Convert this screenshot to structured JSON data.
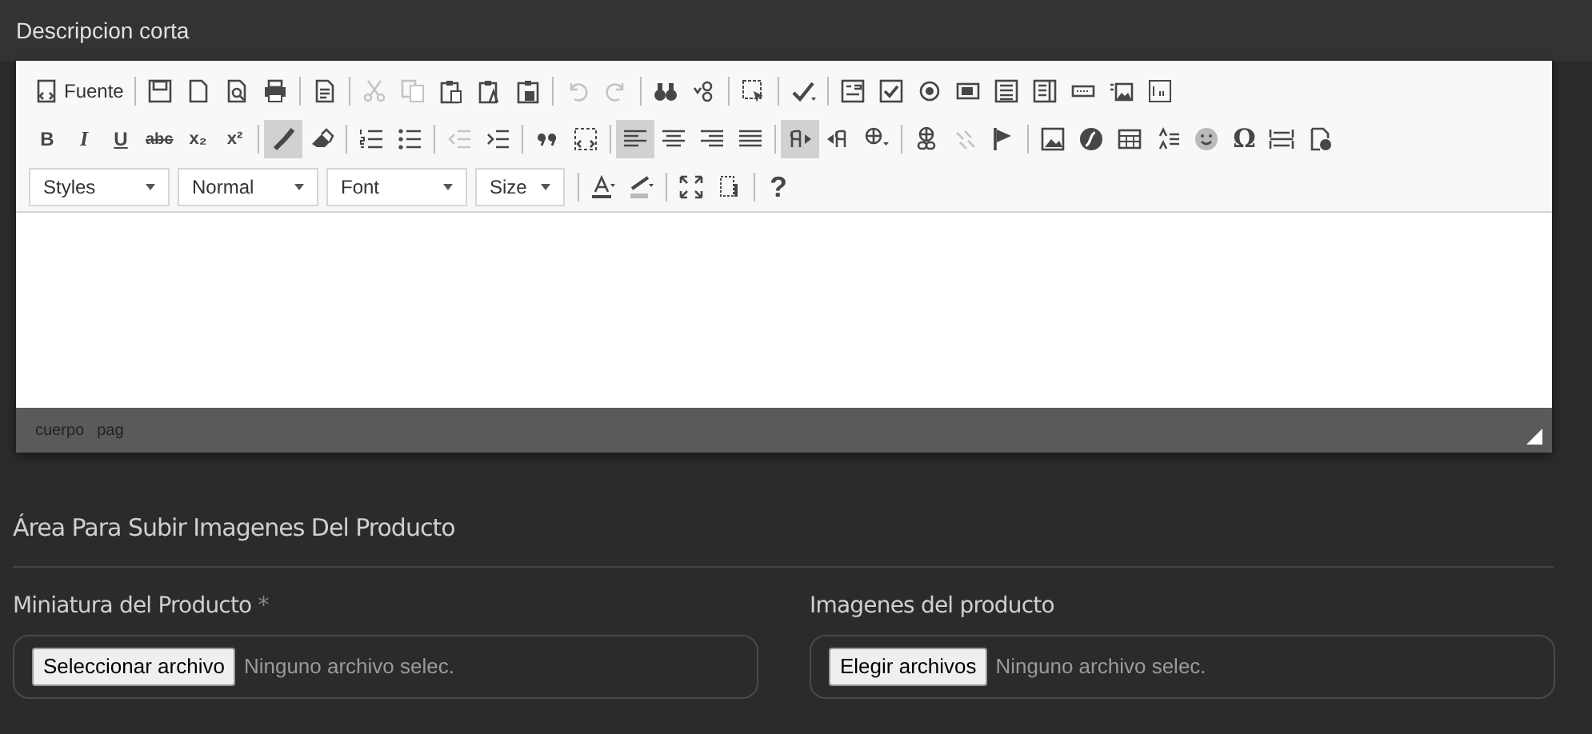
{
  "section_title": "Descripcion corta",
  "toolbar": {
    "rows": [
      [
        {
          "kind": "buttons",
          "items": [
            {
              "label": "Fuente",
              "selected": false,
              "disabled": false
            }
          ]
        },
        {
          "kind": "buttons",
          "items": [
            {
              "selected": false,
              "disabled": false
            },
            {
              "selected": false,
              "disabled": false
            },
            {
              "selected": false,
              "disabled": false
            },
            {
              "selected": false,
              "disabled": false
            }
          ]
        },
        {
          "kind": "buttons",
          "items": [
            {
              "selected": false,
              "disabled": false
            }
          ]
        },
        {
          "kind": "buttons",
          "items": [
            {
              "selected": false,
              "disabled": true
            },
            {
              "selected": false,
              "disabled": true
            },
            {
              "selected": false,
              "disabled": false
            },
            {
              "selected": false,
              "disabled": false
            },
            {
              "selected": false,
              "disabled": false
            }
          ]
        },
        {
          "kind": "buttons",
          "items": [
            {
              "selected": false,
              "disabled": true
            },
            {
              "selected": false,
              "disabled": true
            }
          ]
        },
        {
          "kind": "buttons",
          "items": [
            {
              "selected": false,
              "disabled": false
            },
            {
              "selected": false,
              "disabled": false
            }
          ]
        },
        {
          "kind": "buttons",
          "items": [
            {
              "selected": false,
              "disabled": false
            }
          ]
        },
        {
          "kind": "buttons",
          "items": [
            {
              "selected": false,
              "disabled": false
            }
          ]
        },
        {
          "kind": "buttons",
          "items": [
            {
              "selected": false,
              "disabled": false
            },
            {
              "selected": false,
              "disabled": false
            },
            {
              "selected": false,
              "disabled": false
            },
            {
              "selected": false,
              "disabled": false
            },
            {
              "selected": false,
              "disabled": false
            },
            {
              "selected": false,
              "disabled": false
            },
            {
              "selected": false,
              "disabled": false
            },
            {
              "selected": false,
              "disabled": false
            },
            {
              "selected": false,
              "disabled": false
            }
          ]
        }
      ],
      [
        {
          "kind": "buttons",
          "items": [
            {
              "label": "B",
              "selected": false,
              "disabled": false
            },
            {
              "label": "I",
              "selected": false,
              "disabled": false
            },
            {
              "label": "U",
              "selected": false,
              "disabled": false
            },
            {
              "label": "abc",
              "selected": false,
              "disabled": false
            },
            {
              "label": "x₂",
              "selected": false,
              "disabled": false
            },
            {
              "label": "x²",
              "selected": false,
              "disabled": false
            }
          ]
        },
        {
          "kind": "buttons",
          "items": [
            {
              "selected": true,
              "disabled": false
            },
            {
              "selected": false,
              "disabled": false
            }
          ]
        },
        {
          "kind": "buttons",
          "items": [
            {
              "selected": false,
              "disabled": false
            },
            {
              "selected": false,
              "disabled": false
            }
          ]
        },
        {
          "kind": "buttons",
          "items": [
            {
              "selected": false,
              "disabled": true
            },
            {
              "selected": false,
              "disabled": false
            }
          ]
        },
        {
          "kind": "buttons",
          "items": [
            {
              "selected": false,
              "disabled": false
            },
            {
              "selected": false,
              "disabled": false
            }
          ]
        },
        {
          "kind": "buttons",
          "items": [
            {
              "selected": true,
              "disabled": false
            },
            {
              "selected": false,
              "disabled": false
            },
            {
              "selected": false,
              "disabled": false
            },
            {
              "selected": false,
              "disabled": false
            }
          ]
        },
        {
          "kind": "buttons",
          "items": [
            {
              "selected": true,
              "disabled": false
            },
            {
              "selected": false,
              "disabled": false
            },
            {
              "selected": false,
              "disabled": false
            }
          ]
        },
        {
          "kind": "buttons",
          "items": [
            {
              "selected": false,
              "disabled": false
            },
            {
              "selected": false,
              "disabled": true
            },
            {
              "selected": false,
              "disabled": false
            }
          ]
        },
        {
          "kind": "buttons",
          "items": [
            {
              "selected": false,
              "disabled": false
            },
            {
              "selected": false,
              "disabled": false
            },
            {
              "selected": false,
              "disabled": false
            },
            {
              "selected": false,
              "disabled": false
            },
            {
              "selected": false,
              "disabled": false
            },
            {
              "label": "Ω",
              "selected": false,
              "disabled": false
            },
            {
              "selected": false,
              "disabled": false
            },
            {
              "selected": false,
              "disabled": false
            }
          ]
        }
      ],
      [
        {
          "kind": "combos",
          "items": [
            {
              "label": "Styles"
            },
            {
              "label": "Normal"
            },
            {
              "label": "Font"
            },
            {
              "label": "Size"
            }
          ]
        },
        {
          "kind": "buttons",
          "items": [
            {
              "selected": false,
              "disabled": false
            },
            {
              "selected": false,
              "disabled": false
            }
          ]
        },
        {
          "kind": "buttons",
          "items": [
            {
              "selected": false,
              "disabled": false
            },
            {
              "selected": false,
              "disabled": false
            }
          ]
        },
        {
          "kind": "buttons",
          "items": [
            {
              "label": "?",
              "selected": false,
              "disabled": false
            }
          ]
        }
      ]
    ]
  },
  "status_path": [
    "cuerpo",
    "pag"
  ],
  "upload_section": {
    "title": "Área Para Subir Imagenes Del Producto",
    "fields": [
      {
        "label": "Miniatura del Producto",
        "required_mark": "*",
        "button": "Seleccionar archivo",
        "status": "Ninguno archivo selec."
      },
      {
        "label": "Imagenes del producto",
        "button": "Elegir archivos",
        "status": "Ninguno archivo selec."
      }
    ]
  }
}
